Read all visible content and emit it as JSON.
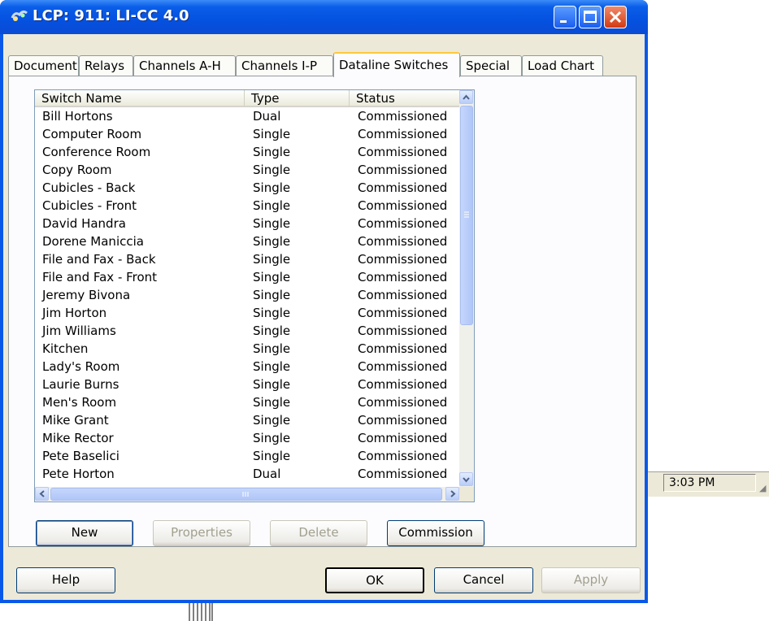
{
  "window": {
    "title": "LCP: 911: LI-CC 4.0",
    "buttons": {
      "minimize": "minimize",
      "maximize": "maximize",
      "close": "close"
    }
  },
  "tabs": [
    {
      "label": "Document",
      "active": false
    },
    {
      "label": "Relays",
      "active": false
    },
    {
      "label": "Channels A-H",
      "active": false
    },
    {
      "label": "Channels I-P",
      "active": false
    },
    {
      "label": "Dataline Switches",
      "active": true
    },
    {
      "label": "Special",
      "active": false
    },
    {
      "label": "Load Chart",
      "active": false
    }
  ],
  "list": {
    "columns": [
      "Switch Name",
      "Type",
      "Status"
    ],
    "rows": [
      [
        "Bill Hortons",
        "Dual",
        "Commissioned"
      ],
      [
        "Computer Room",
        "Single",
        "Commissioned"
      ],
      [
        "Conference Room",
        "Single",
        "Commissioned"
      ],
      [
        "Copy Room",
        "Single",
        "Commissioned"
      ],
      [
        "Cubicles - Back",
        "Single",
        "Commissioned"
      ],
      [
        "Cubicles - Front",
        "Single",
        "Commissioned"
      ],
      [
        "David Handra",
        "Single",
        "Commissioned"
      ],
      [
        "Dorene Maniccia",
        "Single",
        "Commissioned"
      ],
      [
        "File and Fax - Back",
        "Single",
        "Commissioned"
      ],
      [
        "File and Fax - Front",
        "Single",
        "Commissioned"
      ],
      [
        "Jeremy Bivona",
        "Single",
        "Commissioned"
      ],
      [
        "Jim Horton",
        "Single",
        "Commissioned"
      ],
      [
        "Jim Williams",
        "Single",
        "Commissioned"
      ],
      [
        "Kitchen",
        "Single",
        "Commissioned"
      ],
      [
        "Lady's Room",
        "Single",
        "Commissioned"
      ],
      [
        "Laurie Burns",
        "Single",
        "Commissioned"
      ],
      [
        "Men's Room",
        "Single",
        "Commissioned"
      ],
      [
        "Mike Grant",
        "Single",
        "Commissioned"
      ],
      [
        "Mike Rector",
        "Single",
        "Commissioned"
      ],
      [
        "Pete Baselici",
        "Single",
        "Commissioned"
      ],
      [
        "Pete Horton",
        "Dual",
        "Commissioned"
      ]
    ]
  },
  "tab_buttons": {
    "new": "New",
    "properties": "Properties",
    "delete": "Delete",
    "commission": "Commission"
  },
  "dialog_buttons": {
    "help": "Help",
    "ok": "OK",
    "cancel": "Cancel",
    "apply": "Apply"
  },
  "background": {
    "clock": "3:03 PM"
  },
  "colors": {
    "titlebar": "#0551e0",
    "face": "#ece9d8",
    "accent_tab": "#ffc83c"
  }
}
